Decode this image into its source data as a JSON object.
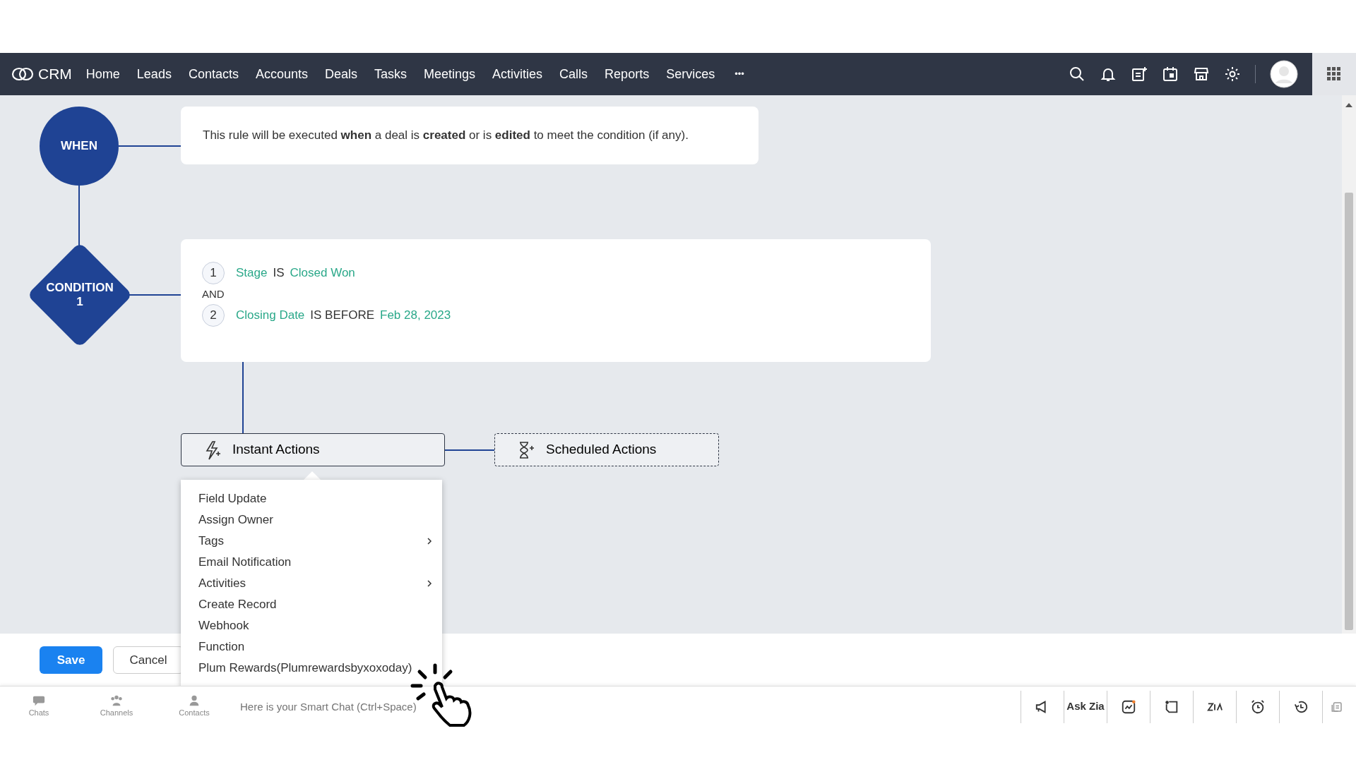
{
  "navbar": {
    "brand": "CRM",
    "tabs": [
      {
        "label": "Home",
        "selected": false
      },
      {
        "label": "Leads",
        "selected": false
      },
      {
        "label": "Contacts",
        "selected": false
      },
      {
        "label": "Accounts",
        "selected": false
      },
      {
        "label": "Deals",
        "selected": false
      },
      {
        "label": "Tasks",
        "selected": false
      },
      {
        "label": "Meetings",
        "selected": false
      },
      {
        "label": "Activities",
        "selected": false
      },
      {
        "label": "Calls",
        "selected": false
      },
      {
        "label": "Reports",
        "selected": false
      },
      {
        "label": "Services",
        "selected": false
      }
    ],
    "more": "•••"
  },
  "flow": {
    "when": {
      "label": "WHEN",
      "text": "This rule will be executed **when** a deal is **created** or is **edited** to meet the condition (if any)."
    },
    "condition": {
      "label": "CONDITION 1",
      "joiner": "AND",
      "criteria": [
        {
          "number": "1",
          "field": "Stage",
          "operator": "IS",
          "value": "Closed Won"
        },
        {
          "number": "2",
          "field": "Closing Date",
          "operator": "IS BEFORE",
          "value": "Feb 28, 2023"
        }
      ]
    },
    "actions": [
      {
        "label": "Instant Actions",
        "kind": "instant"
      },
      {
        "label": "Scheduled Actions",
        "kind": "scheduled"
      }
    ],
    "menu": [
      {
        "label": "Field Update",
        "submenu": false
      },
      {
        "label": "Assign Owner",
        "submenu": false
      },
      {
        "label": "Tags",
        "submenu": true
      },
      {
        "label": "Email Notification",
        "submenu": false
      },
      {
        "label": "Activities",
        "submenu": true
      },
      {
        "label": "Create Record",
        "submenu": false
      },
      {
        "label": "Webhook",
        "submenu": false
      },
      {
        "label": "Function",
        "submenu": false
      },
      {
        "label": "Plum Rewards(Plumrewardsbyxoxoday)",
        "submenu": false
      }
    ]
  },
  "footer": {
    "buttons": [
      {
        "label": "Save",
        "kind": "primary"
      },
      {
        "label": "Cancel",
        "kind": "secondary"
      }
    ]
  },
  "chatbar": {
    "items": [
      {
        "label": "Chats",
        "kind": "chats"
      },
      {
        "label": "Channels",
        "kind": "channels"
      },
      {
        "label": "Contacts",
        "kind": "contacts"
      }
    ],
    "placeholder": "Here is your Smart Chat (Ctrl+Space)",
    "ask_zia": "Ask Zia"
  }
}
